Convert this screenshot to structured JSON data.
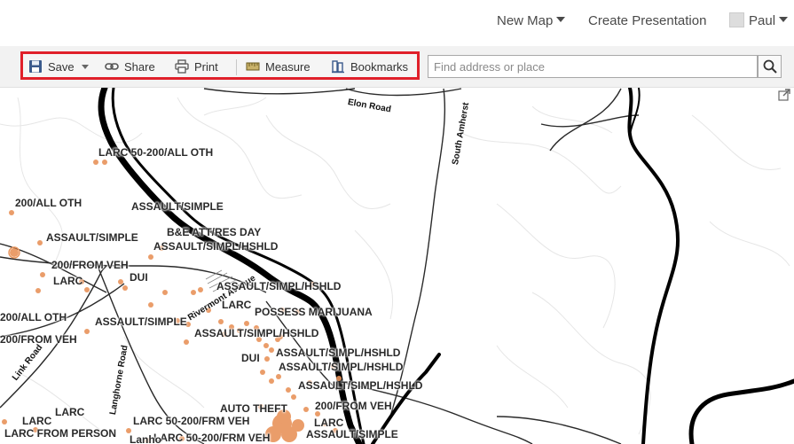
{
  "header": {
    "new_map": "New Map",
    "create_presentation": "Create Presentation",
    "user_name": "Paul"
  },
  "toolbar": {
    "save": "Save",
    "share": "Share",
    "print": "Print",
    "measure": "Measure",
    "bookmarks": "Bookmarks"
  },
  "search": {
    "placeholder": "Find address or place"
  },
  "colors": {
    "highlight_border": "#e0202a",
    "incident_point": "#e8935a"
  },
  "map": {
    "roads": [
      "Elon Road",
      "South Amherst",
      "Link Road",
      "Langhorne Road",
      "Rivermont Avenue"
    ],
    "incident_labels": [
      "LARC 50-200/ALL OTH",
      "200/ALL OTH",
      "ASSAULT/SIMPLE",
      "ASSAULT/SIMPLE",
      "B&E ATT/RES DAY",
      "ASSAULT/SIMPL/HSHLD",
      "200/FROM VEH",
      "LARC",
      "DUI",
      "ASSAULT/SIMPL/HSHLD",
      "LARC",
      "POSSESS MARIJUANA",
      "200/ALL OTH",
      "ASSAULT/SIMPLE",
      "ASSAULT/SIMPL/HSHLD",
      "200/FROM VEH",
      "ASSAULT/SIMPL/HSHLD",
      "DUI",
      "ASSAULT/SIMPL/HSHLD",
      "ASSAULT/SIMPL/HSHLD",
      "LARC",
      "AUTO THEFT",
      "200/FROM VEH",
      "LARC",
      "LARC 50-200/FRM VEH",
      "LARC",
      "LARC FROM PERSON",
      "LARC 50-200/FRM VEH",
      "ASSAULT/SIMPLE",
      "Lanho"
    ]
  }
}
